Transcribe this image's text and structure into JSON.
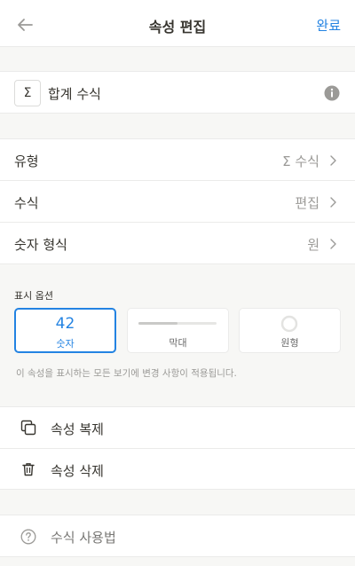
{
  "header": {
    "title": "속성 편집",
    "done_label": "완료",
    "back_icon": "arrow-left-icon"
  },
  "property": {
    "type_symbol": "Σ",
    "name": "합계 수식"
  },
  "settings": [
    {
      "label": "유형",
      "value": "Σ 수식"
    },
    {
      "label": "수식",
      "value": "편집"
    },
    {
      "label": "숫자 형식",
      "value": "원"
    }
  ],
  "display": {
    "label": "표시 옵션",
    "options": [
      {
        "caption": "숫자",
        "sample": "42",
        "selected": true
      },
      {
        "caption": "막대",
        "selected": false,
        "bar_fill_fraction": 0.5
      },
      {
        "caption": "원형",
        "selected": false
      }
    ],
    "note": "이 속성을 표시하는 모든 보기에 변경 사항이 적용됩니다."
  },
  "actions": [
    {
      "label": "속성 복제",
      "icon": "duplicate-icon"
    },
    {
      "label": "속성 삭제",
      "icon": "trash-icon"
    }
  ],
  "help": {
    "label": "수식 사용법",
    "icon": "question-circle-icon"
  },
  "colors": {
    "accent": "#2383e2",
    "muted": "#9b9a97",
    "background": "#f7f7f5"
  }
}
